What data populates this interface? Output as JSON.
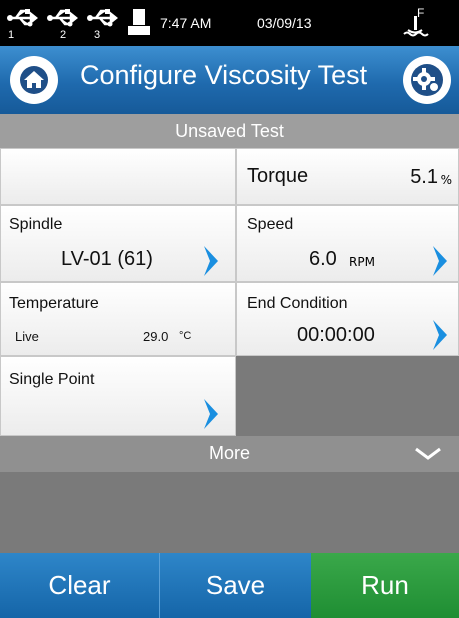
{
  "status": {
    "usb_ports": [
      "1",
      "2",
      "3"
    ],
    "time": "7:47 AM",
    "date": "03/09/13",
    "probe_label": "F"
  },
  "header": {
    "title": "Configure Viscosity Test",
    "home_icon": "home-icon",
    "settings_icon": "gear-icon"
  },
  "subtitle": "Unsaved Test",
  "torque": {
    "label": "Torque",
    "value": "5.1",
    "unit": "%"
  },
  "spindle": {
    "label": "Spindle",
    "value": "LV-01 (61)"
  },
  "speed": {
    "label": "Speed",
    "value": "6.0",
    "unit": "RPM"
  },
  "temperature": {
    "label": "Temperature",
    "mode": "Live",
    "value": "29.0",
    "unit": "°C"
  },
  "end_condition": {
    "label": "End Condition",
    "value": "00:00:00"
  },
  "single_point": {
    "label": "Single Point"
  },
  "more": "More",
  "buttons": {
    "clear": "Clear",
    "save": "Save",
    "run": "Run"
  },
  "colors": {
    "header_blue": "#1f6aae",
    "chevron_blue": "#1a8fe0",
    "run_green": "#2a9a3e"
  }
}
